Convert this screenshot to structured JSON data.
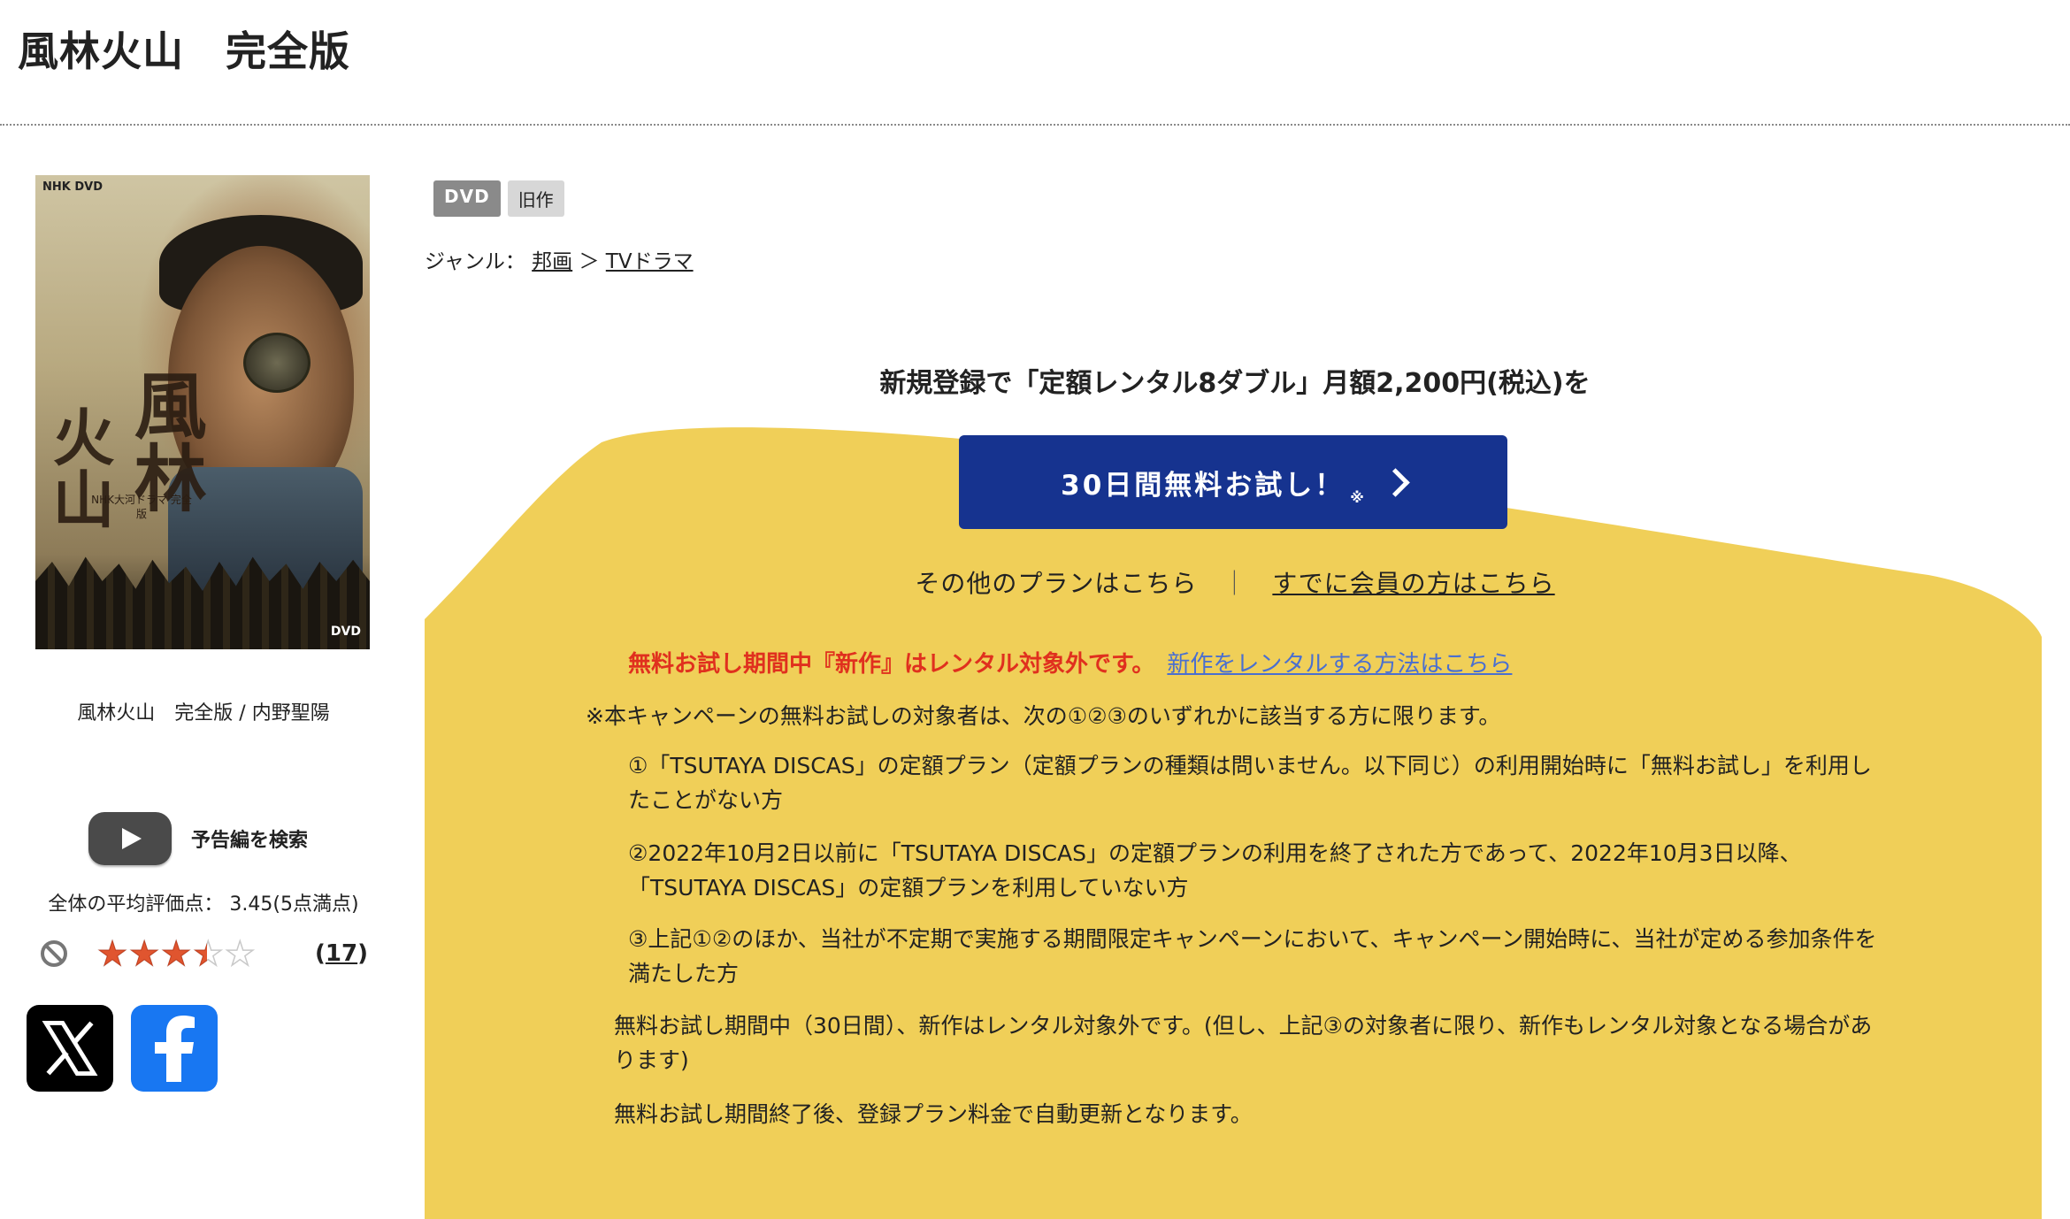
{
  "page": {
    "title": "風林火山　完全版"
  },
  "cover": {
    "logo": "NHK DVD",
    "calligraphy_left": "火山",
    "calligraphy_right": "風林",
    "subtitle_lines": "NHK大河ドラマ 完全版",
    "disc_mark": "DVD"
  },
  "item": {
    "caption": "風林火山　完全版 / 内野聖陽",
    "trailer_label": "予告編を検索",
    "rating_text": "全体の平均評価点： 3.45(5点満点)",
    "rating_value": 3.45,
    "rating_max": 5,
    "review_count_open": "(",
    "review_count": "17",
    "review_count_close": ")"
  },
  "badges": {
    "format": "DVD",
    "status": "旧作"
  },
  "genre": {
    "prefix": "ジャンル：",
    "level1": "邦画",
    "separator": "＞",
    "level2": "TVドラマ"
  },
  "promo": {
    "headline": "新規登録で「定額レンタル8ダブル」月額2,200円(税込)を",
    "cta_label": "30日間無料お試し！",
    "cta_note": "※",
    "other_plans": "その他のプランはこちら",
    "separator": "｜",
    "member_link": "すでに会員の方はこちら",
    "warning": "無料お試し期間中『新作』はレンタル対象外です。",
    "warning_link": "新作をレンタルする方法はこちら",
    "accent_color": "#f0cf58",
    "button_color": "#16338f"
  },
  "terms": {
    "intro": "※本キャンペーンの無料お試しの対象者は、次の①②③のいずれかに該当する方に限ります。",
    "item1": "①「TSUTAYA DISCAS」の定額プラン（定額プランの種類は問いません。以下同じ）の利用開始時に「無料お試し」を利用したことがない方",
    "item2": "②2022年10月2日以前に「TSUTAYA DISCAS」の定額プランの利用を終了された方であって、2022年10月3日以降、「TSUTAYA DISCAS」の定額プランを利用していない方",
    "item3": "③上記①②のほか、当社が不定期で実施する期間限定キャンペーンにおいて、キャンペーン開始時に、当社が定める参加条件を満たした方",
    "note1": "無料お試し期間中（30日間）、新作はレンタル対象外です。(但し、上記③の対象者に限り、新作もレンタル対象となる場合があります)",
    "note2": "無料お試し期間終了後、登録プラン料金で自動更新となります。"
  },
  "icons": [
    "youtube-play-icon",
    "ban-icon",
    "star-rating-icon",
    "x-logo-icon",
    "facebook-logo-icon",
    "chevron-right-icon"
  ]
}
